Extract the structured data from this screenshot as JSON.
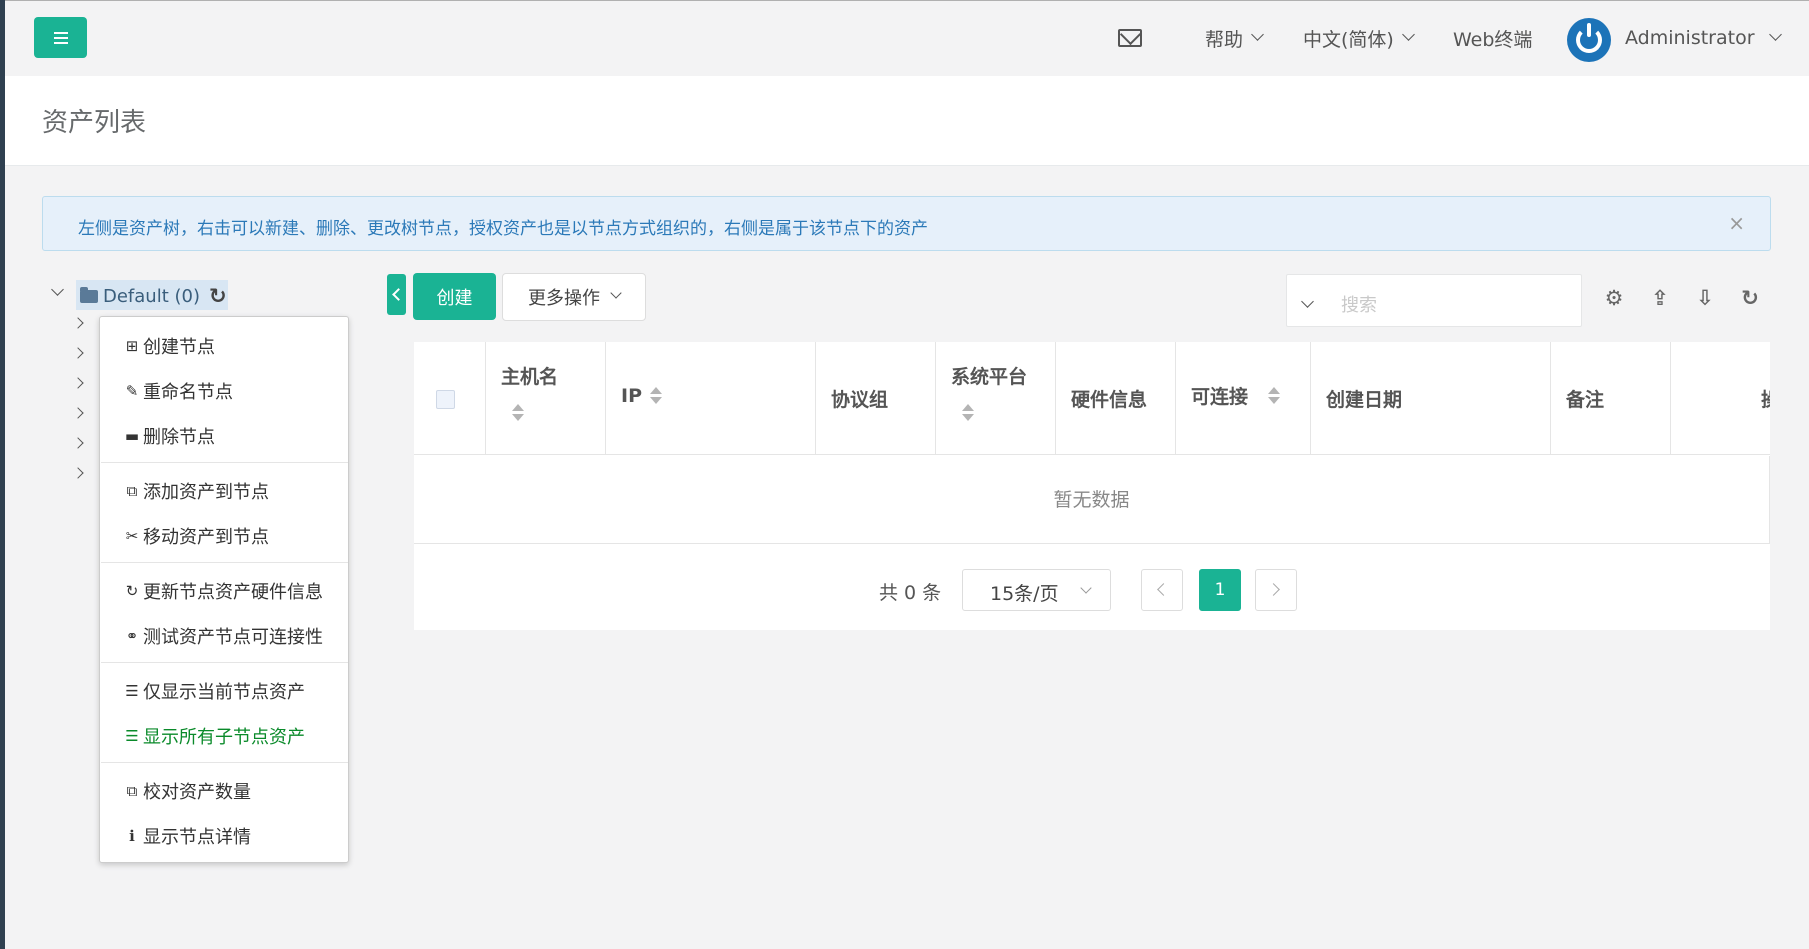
{
  "topbar": {
    "help": "帮助",
    "language": "中文(简体)",
    "web_terminal": "Web终端",
    "user": "Administrator"
  },
  "page_title": "资产列表",
  "alert": {
    "text": "左侧是资产树，右击可以新建、删除、更改树节点，授权资产也是以节点方式组织的，右侧是属于该节点下的资产",
    "close": "×"
  },
  "tree": {
    "root_label": "Default (0)",
    "refresh": "↻"
  },
  "context_menu": {
    "items": [
      {
        "label": "创建节点",
        "icon": "⊞"
      },
      {
        "label": "重命名节点",
        "icon": "✎"
      },
      {
        "label": "删除节点",
        "icon": "▬"
      },
      {
        "label": "添加资产到节点",
        "icon": "⧉"
      },
      {
        "label": "移动资产到节点",
        "icon": "✂"
      },
      {
        "label": "更新节点资产硬件信息",
        "icon": "↻"
      },
      {
        "label": "测试资产节点可连接性",
        "icon": "⚭"
      },
      {
        "label": "仅显示当前节点资产",
        "icon": "☰"
      },
      {
        "label": "显示所有子节点资产",
        "icon": "☰"
      },
      {
        "label": "校对资产数量",
        "icon": "⧉"
      },
      {
        "label": "显示节点详情",
        "icon": "ℹ"
      }
    ],
    "active_color": "#0a8a2a"
  },
  "toolbar": {
    "create": "创建",
    "more": "更多操作",
    "search_placeholder": "搜索",
    "icons": [
      "⚙",
      "⇪",
      "⇩",
      "↻"
    ]
  },
  "table": {
    "columns": [
      "主机名",
      "IP",
      "协议组",
      "系统平台",
      "硬件信息",
      "可连接",
      "创建日期",
      "备注",
      "操"
    ],
    "empty": "暂无数据"
  },
  "pager": {
    "total": "共 0 条",
    "page_size": "15条/页",
    "current_page": "1"
  },
  "colors": {
    "primary": "#1ab394",
    "alert_text": "#2b79b8",
    "avatar": "#1c73b8"
  }
}
